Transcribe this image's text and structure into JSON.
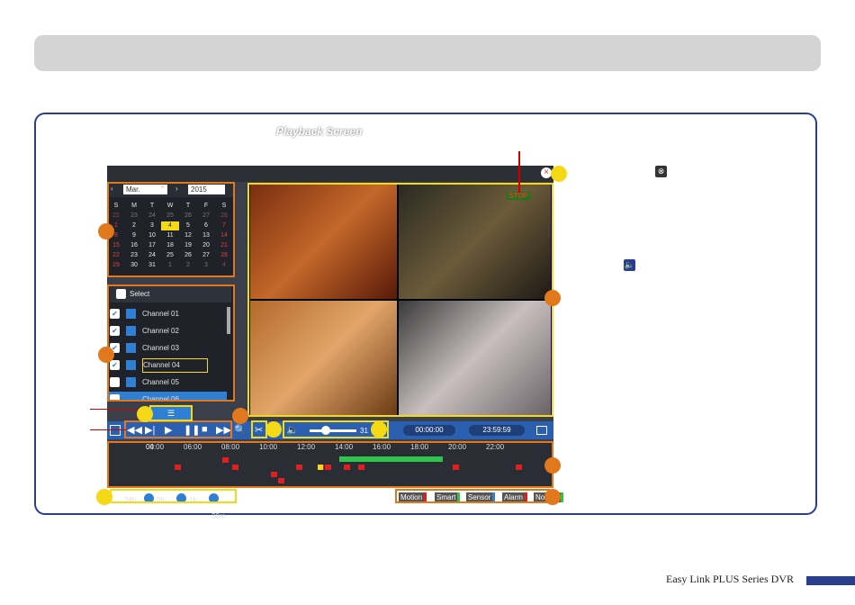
{
  "screen_title": "Playback Screen",
  "calendar": {
    "month": "Mar.",
    "year": "2015",
    "weekdays": [
      "S",
      "M",
      "T",
      "W",
      "T",
      "F",
      "S"
    ],
    "rows": [
      [
        "22",
        "23",
        "24",
        "25",
        "26",
        "27",
        "28"
      ],
      [
        "1",
        "2",
        "3",
        "4",
        "5",
        "6",
        "7"
      ],
      [
        "8",
        "9",
        "10",
        "11",
        "12",
        "13",
        "14"
      ],
      [
        "15",
        "16",
        "17",
        "18",
        "19",
        "20",
        "21"
      ],
      [
        "22",
        "23",
        "24",
        "25",
        "26",
        "27",
        "28"
      ],
      [
        "29",
        "30",
        "31",
        "1",
        "2",
        "3",
        "4"
      ]
    ],
    "selected_day": "4"
  },
  "channels": {
    "select_label": "Select",
    "items": [
      "Channel 01",
      "Channel 02",
      "Channel 03",
      "Channel 04",
      "Channel 05",
      "Channel 06"
    ]
  },
  "stop_label": "STOP",
  "controls": {
    "volume_value": "31",
    "time_start": "00:00:00",
    "time_end": "23:59:59"
  },
  "timeline": {
    "ticks": [
      "00",
      "04:00",
      "06:00",
      "08:00",
      "10:00",
      "12:00",
      "14:00",
      "16:00",
      "18:00",
      "20:00",
      "22:00"
    ]
  },
  "zoom_options": [
    "24h",
    "2h",
    "1h",
    "30m"
  ],
  "legend": [
    "Motion",
    "Smart",
    "Sensor",
    "Alarm",
    "Normal"
  ],
  "footer": "Easy Link PLUS Series DVR",
  "colors": {
    "accent": "#e2781c",
    "highlight": "#f4d916",
    "brand": "#2a3e8e"
  }
}
